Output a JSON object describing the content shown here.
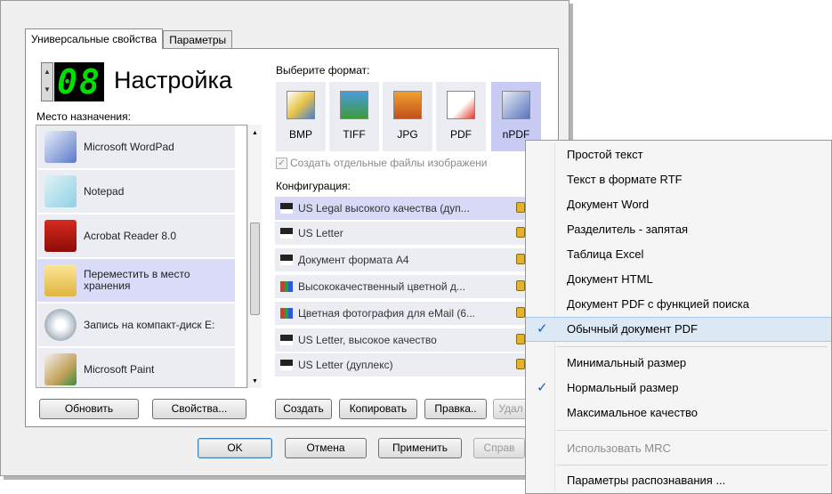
{
  "tabs": [
    "Универсальные свойства",
    "Параметры"
  ],
  "counter": {
    "value": "08",
    "title": "Настройка"
  },
  "destination": {
    "label": "Место назначения:",
    "items": [
      {
        "label": "Microsoft WordPad",
        "icon": "wordpad-icon"
      },
      {
        "label": "Notepad",
        "icon": "notepad-icon"
      },
      {
        "label": "Acrobat Reader 8.0",
        "icon": "acrobat-icon"
      },
      {
        "label": "Переместить в место хранения",
        "icon": "folder-icon"
      },
      {
        "label": "Запись на компакт-диск E:",
        "icon": "cd-burner-icon"
      },
      {
        "label": "Microsoft Paint",
        "icon": "paint-icon"
      }
    ],
    "refresh_button": "Обновить",
    "properties_button": "Свойства..."
  },
  "format": {
    "label": "Выберите формат:",
    "items": [
      "BMP",
      "TIFF",
      "JPG",
      "PDF",
      "nPDF"
    ],
    "separate_files_checkbox": "Создать отдельные файлы изображени",
    "separate_files_checked": true
  },
  "configuration": {
    "label": "Конфигурация:",
    "items": [
      "US Legal высокого качества (дуп...",
      "US Letter",
      "Документ формата A4",
      "Высококачественный цветной д...",
      "Цветная фотография для eMail (6...",
      "US Letter, высокое качество",
      "US Letter (дуплекс)"
    ],
    "buttons": {
      "create": "Создать",
      "copy": "Копировать",
      "edit": "Правка..",
      "delete": "Удал"
    }
  },
  "dialog_buttons": {
    "ok": "OK",
    "cancel": "Отмена",
    "apply": "Применить",
    "help": "Справ"
  },
  "context_menu": {
    "items": [
      {
        "label": "Простой текст",
        "checked": false,
        "disabled": false
      },
      {
        "label": "Текст в формате RTF",
        "checked": false,
        "disabled": false
      },
      {
        "label": "Документ Word",
        "checked": false,
        "disabled": false
      },
      {
        "label": "Разделитель - запятая",
        "checked": false,
        "disabled": false
      },
      {
        "label": "Таблица Excel",
        "checked": false,
        "disabled": false
      },
      {
        "label": "Документ HTML",
        "checked": false,
        "disabled": false
      },
      {
        "label": "Документ PDF с функцией поиска",
        "checked": false,
        "disabled": false
      },
      {
        "label": "Обычный документ PDF",
        "checked": true,
        "disabled": false
      },
      {
        "label": "Минимальный размер",
        "checked": false,
        "disabled": false
      },
      {
        "label": "Нормальный размер",
        "checked": true,
        "disabled": false
      },
      {
        "label": "Максимальное качество",
        "checked": false,
        "disabled": false
      },
      {
        "label": "Использовать MRC",
        "checked": false,
        "disabled": true
      },
      {
        "label": "Параметры распознавания ...",
        "checked": false,
        "disabled": false
      }
    ],
    "check_mark": "✓"
  },
  "colors": {
    "lcd": "#00e000",
    "selected_row": "#d9dbf8",
    "menu_highlight": "#dde8f5"
  }
}
